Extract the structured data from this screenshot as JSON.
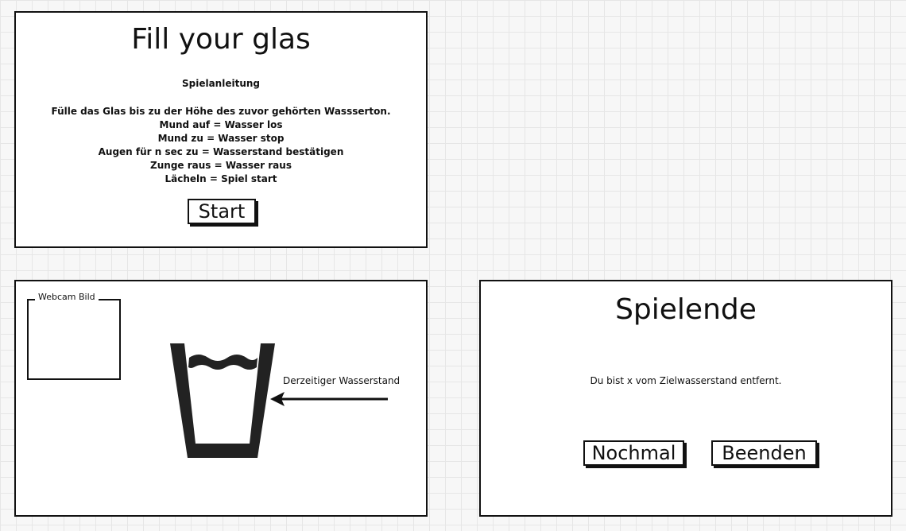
{
  "start_screen": {
    "title": "Fill your glas",
    "instructions_heading": "Spielanleitung",
    "instructions": [
      "Fülle das Glas bis zu der Höhe des zuvor gehörten Wassserton.",
      "Mund auf = Wasser los",
      "Mund zu = Wasser stop",
      "Augen für n sec zu = Wasserstand bestätigen",
      "Zunge raus = Wasser raus",
      "Lächeln = Spiel start"
    ],
    "start_button": "Start"
  },
  "game_screen": {
    "webcam_label": "Webcam Bild",
    "water_level_label": "Derzeitiger Wasserstand",
    "glass_icon": "glass-with-water-icon",
    "arrow_icon": "arrow-left-icon"
  },
  "end_screen": {
    "title": "Spielende",
    "result_text": "Du bist x vom Zielwasserstand entfernt.",
    "again_button": "Nochmal",
    "quit_button": "Beenden"
  }
}
